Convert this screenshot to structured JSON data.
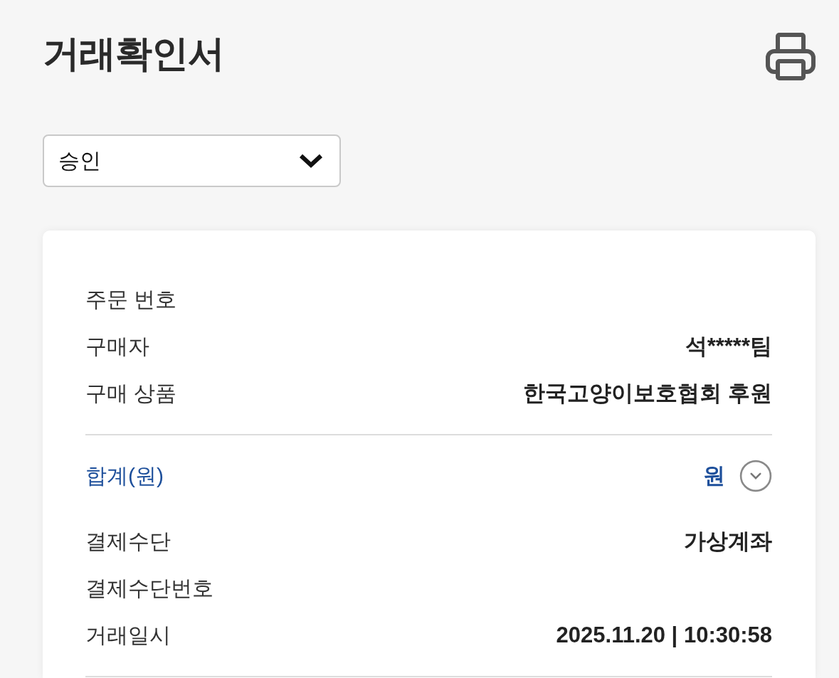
{
  "title": "거래확인서",
  "status_select": {
    "value": "승인"
  },
  "card": {
    "sections": [
      {
        "rows": [
          {
            "kind": "detail",
            "label": "주문 번호"
          },
          {
            "kind": "detail",
            "label": "구매자",
            "value": "석*****팀"
          },
          {
            "kind": "detail",
            "label": "구매 상품",
            "value": "한국고양이보호협회 후원"
          }
        ]
      },
      {
        "rows": [
          {
            "kind": "total",
            "label": "합계(원)",
            "value": "원",
            "expanded": false
          },
          {
            "kind": "detail",
            "label": "결제수단",
            "value": "가상계좌"
          },
          {
            "kind": "detail",
            "label": "결제수단번호"
          },
          {
            "kind": "detail",
            "label": "거래일시",
            "value": "2025.11.20 | 10:30:58"
          }
        ]
      }
    ]
  }
}
